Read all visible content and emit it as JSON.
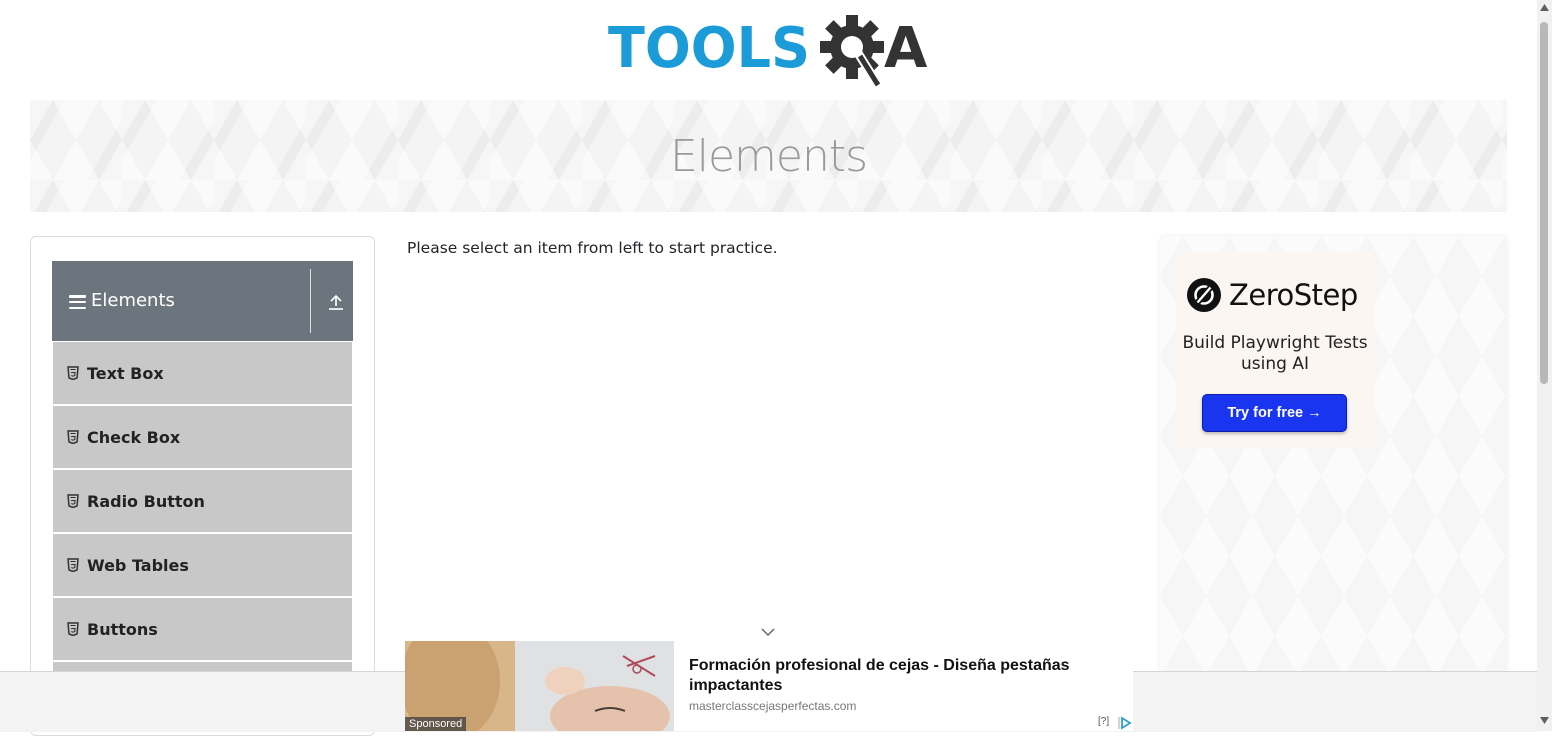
{
  "logo": {
    "text_left": "TOOLS",
    "text_right": "A",
    "colors": {
      "tools": "#1b9bd7",
      "qa": "#333333"
    }
  },
  "banner": {
    "title": "Elements"
  },
  "sidebar": {
    "group_title": "Elements",
    "items": [
      {
        "label": "Text Box",
        "icon": "html5-icon"
      },
      {
        "label": "Check Box",
        "icon": "html5-icon"
      },
      {
        "label": "Radio Button",
        "icon": "html5-icon"
      },
      {
        "label": "Web Tables",
        "icon": "html5-icon"
      },
      {
        "label": "Buttons",
        "icon": "html5-icon"
      }
    ],
    "colors": {
      "header": "#6c757d",
      "item": "#c8c8c8"
    }
  },
  "main": {
    "intro": "Please select an item from left to start practice."
  },
  "side_ad": {
    "brand": "ZeroStep",
    "tagline": "Build Playwright Tests using AI",
    "cta": "Try for free →",
    "colors": {
      "cta": "#1a35f0"
    }
  },
  "bottom_ad": {
    "sponsored": "Sponsored",
    "headline": "Formación profesional de cejas - Diseña pestañas impactantes",
    "url": "masterclasscejasperfectas.com",
    "choices": "[?]"
  }
}
